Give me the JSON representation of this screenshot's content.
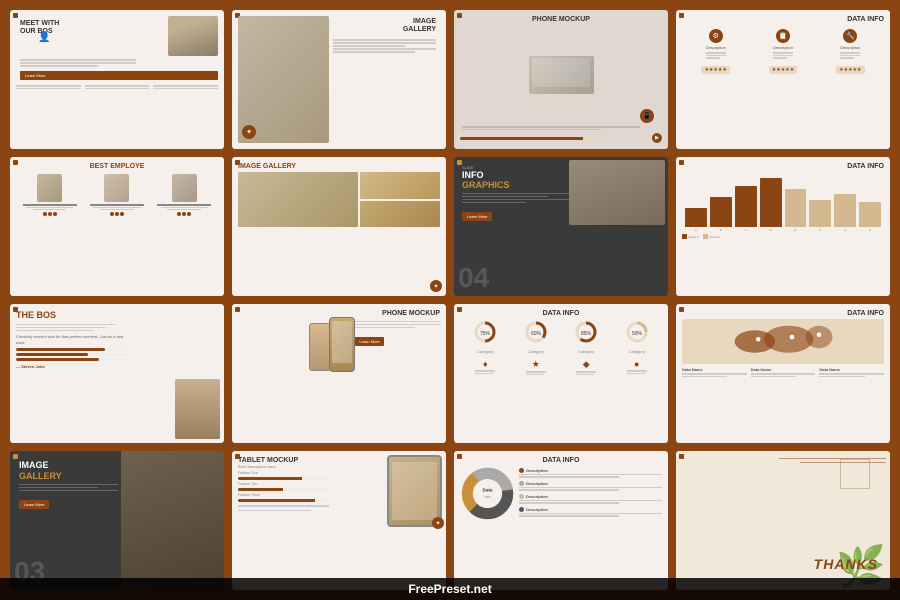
{
  "slides": [
    {
      "id": 1,
      "type": "meet-bos",
      "title": "MEET WITH",
      "title2": "OUR BOS",
      "button_label": "Learn More"
    },
    {
      "id": 2,
      "type": "image-gallery-1",
      "title": "IMAGE",
      "title2": "GALLERY"
    },
    {
      "id": 3,
      "type": "phone-mockup-1",
      "title": "PHONE MOCKUP"
    },
    {
      "id": 4,
      "type": "data-info-1",
      "title": "DATA INFO",
      "icon1": "⚙",
      "icon2": "📋",
      "icon3": "🔧",
      "label1": "Description",
      "label2": "Description",
      "label3": "Description",
      "stars": "★★★★★"
    },
    {
      "id": 5,
      "type": "best-employee",
      "title": "BEST",
      "title_accent": "EMPLOYE",
      "emp1_name": "Lorem Ipsum",
      "emp2_name": "Lorem Ipsum",
      "emp3_name": "Lorem Ipsum"
    },
    {
      "id": 6,
      "type": "image-gallery-2",
      "title": "IMAGE",
      "title_accent": "GALLERY"
    },
    {
      "id": 7,
      "type": "info-graphics",
      "label": "SLIDE",
      "title": "INFO",
      "title_accent": "GRAPHICS",
      "num": "04",
      "button_label": "Learn More"
    },
    {
      "id": 8,
      "type": "data-info-2",
      "title": "DATA INFO",
      "bars": [
        30,
        50,
        70,
        85,
        65,
        45,
        55,
        40
      ],
      "bar_labels": [
        "A",
        "B",
        "C",
        "D",
        "E",
        "F",
        "G",
        "H"
      ]
    },
    {
      "id": 9,
      "type": "the-bos",
      "title": "THE",
      "title_accent": "BOS",
      "quote": "Creativity doesn't wait for that perfect moment. Just do it and work.",
      "author": "— Steven Jobs",
      "prog1": 80,
      "prog2": 65,
      "prog3": 75
    },
    {
      "id": 10,
      "type": "phone-mockup-2",
      "title": "PHONE MOCKUP",
      "button_label": "Learn More"
    },
    {
      "id": 11,
      "type": "data-info-3",
      "title": "DATA INFO",
      "circle1_val": "75%",
      "circle2_val": "60%",
      "circle3_val": "85%",
      "circle4_val": "50%",
      "icon1": "♦",
      "icon2": "★",
      "icon3": "◆",
      "icon4": "●"
    },
    {
      "id": 12,
      "type": "data-info-4",
      "title": "DATA INFO",
      "leg1": "Data Name",
      "leg2": "Data Name",
      "leg3": "Data Name"
    },
    {
      "id": 13,
      "type": "image-gallery-dark",
      "title_white": "IMAGE",
      "title_gold": "GALLERY",
      "num": "03",
      "button_label": "Learn More"
    },
    {
      "id": 14,
      "type": "tablet-mockup",
      "title": "TABLET MOCKUP",
      "subtitle": "Brief description here",
      "prog1": 70,
      "prog2": 50,
      "prog3": 85,
      "label1": "Feature One",
      "label2": "Feature Two",
      "label3": "Feature Three"
    },
    {
      "id": 15,
      "type": "data-info-5",
      "title": "DATA INFO",
      "leg1": "Description",
      "leg2": "Description",
      "leg3": "Description",
      "leg4": "Description",
      "donut": {
        "seg1": 35,
        "seg2": 25,
        "seg3": 20,
        "seg4": 20
      }
    },
    {
      "id": 16,
      "type": "thanks",
      "text": "THANKS"
    }
  ],
  "watermark": "FreePreset.net"
}
